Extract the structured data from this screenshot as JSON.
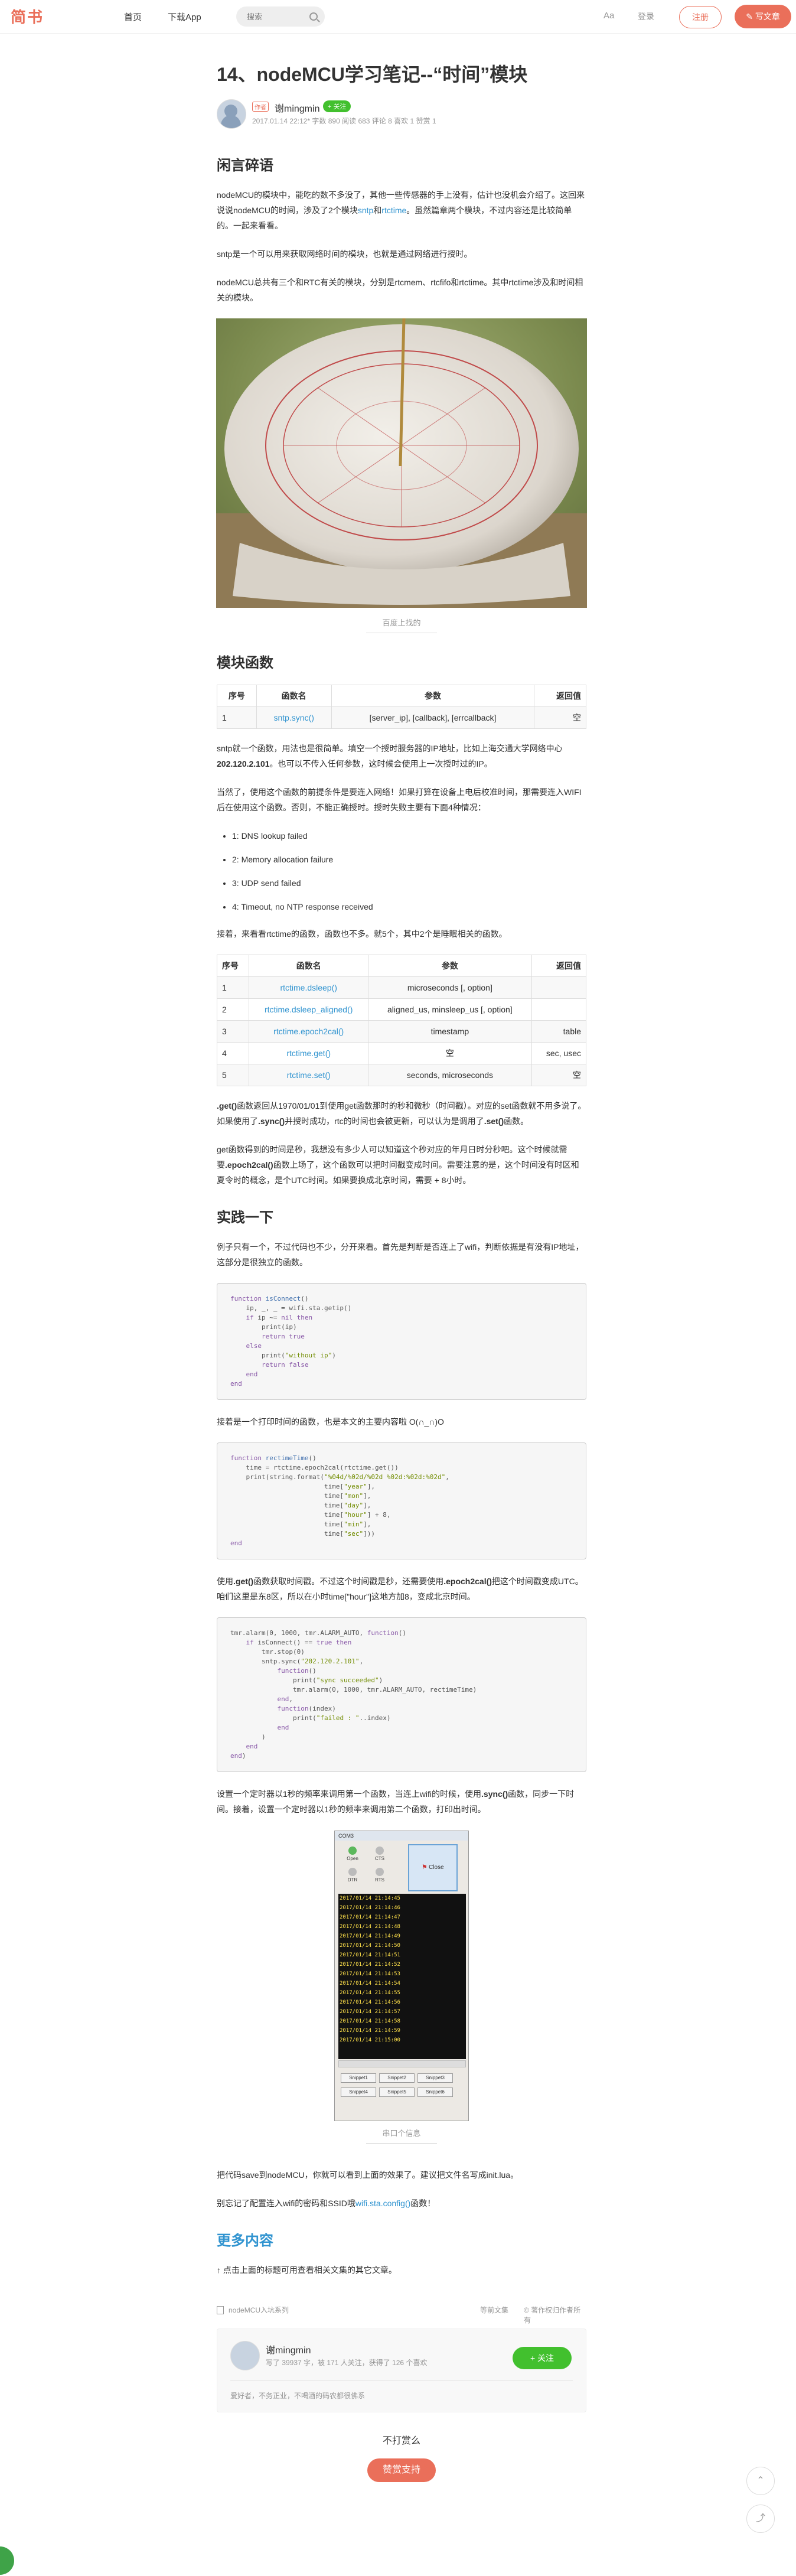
{
  "nav": {
    "logo": "简书",
    "home": "首页",
    "download": "下载App",
    "search_placeholder": "搜索",
    "aa": "Aa",
    "login": "登录",
    "signup": "注册",
    "write": "✎ 写文章"
  },
  "article": {
    "title": "14、nodeMCU学习笔记--“时间”模块",
    "author": {
      "tag": "作者",
      "name": "谢mingmin",
      "follow": "+ 关注",
      "meta": "2017.01.14 22:12* 字数 890 阅读 683 评论 8 喜欢 1 赞赏 1"
    },
    "h_intro": "闲言碎语",
    "p1a": "nodeMCU的模块中，能吃的数不多没了，其他一些传感器的手上没有，估计也没机会介绍了。这回来说说nodeMCU的时间，涉及了2个模块",
    "p1_link1": "sntp",
    "p1_and": "和",
    "p1_link2": "rtctime",
    "p1b": "。虽然篇章两个模块，不过内容还是比较简单的。一起来看看。",
    "p2": "sntp是一个可以用来获取网络时间的模块，也就是通过网络进行授时。",
    "p3": "nodeMCU总共有三个和RTC有关的模块，分别是rtcmem、rtcfifo和rtctime。其中rtctime涉及和时间相关的模块。",
    "img1_caption": "百度上找的",
    "h_funcs": "模块函数",
    "table1": {
      "headers": [
        "序号",
        "函数名",
        "参数",
        "返回值"
      ],
      "rows": [
        [
          "1",
          "sntp.sync()",
          "[server_ip], [callback], [errcallback]",
          "空"
        ]
      ]
    },
    "p4a": "sntp就一个函数，用法也是很简单。填空一个授时服务器的IP地址，比如上海交通大学网络中心",
    "p4_bold": "202.120.2.101",
    "p4b": "。也可以不传入任何参数，这时候会使用上一次授时过的IP。",
    "p5": "当然了，使用这个函数的前提条件是要连入网络！如果打算在设备上电后校准时间，那需要连入WIFI后在使用这个函数。否则，不能正确授时。授时失败主要有下面4种情况：",
    "fail_list": [
      "1: DNS lookup failed",
      "2: Memory allocation failure",
      "3: UDP send failed",
      "4: Timeout, no NTP response received"
    ],
    "p6": "接着，来看看rtctime的函数，函数也不多。就5个，其中2个是睡眠相关的函数。",
    "table2": {
      "headers": [
        "序号",
        "函数名",
        "参数",
        "返回值"
      ],
      "rows": [
        [
          "1",
          "rtctime.dsleep()",
          "microseconds [, option]",
          ""
        ],
        [
          "2",
          "rtctime.dsleep_aligned()",
          "aligned_us, minsleep_us [, option]",
          ""
        ],
        [
          "3",
          "rtctime.epoch2cal()",
          "timestamp",
          "table"
        ],
        [
          "4",
          "rtctime.get()",
          "空",
          "sec, usec"
        ],
        [
          "5",
          "rtctime.set()",
          "seconds, microseconds",
          "空"
        ]
      ]
    },
    "p7a": ".get()",
    "p7b": "函数返回从1970/01/01到使用get函数那时的秒和微秒（时间戳）。对应的set函数就不用多说了。如果使用了",
    "p7c": ".sync()",
    "p7d": "并授时成功，rtc的时间也会被更新，可以认为是调用了",
    "p7e": ".set()",
    "p7f": "函数。",
    "p8a": "get函数得到的时间是秒，我想没有多少人可以知道这个秒对应的年月日时分秒吧。这个时候就需要",
    "p8b": ".epoch2cal()",
    "p8c": "函数上场了，这个函数可以把时间戳变成时间。需要注意的是，这个时间没有时区和夏令时的概念，是个UTC时间。如果要换成北京时间，需要 + 8小时。",
    "h_practice": "实践一下",
    "p9": "例子只有一个，不过代码也不少，分开来看。首先是判断是否连上了wifi，判断依据是有没有IP地址，这部分是很独立的函数。",
    "p10": "接着是一个打印时间的函数，也是本文的主要内容啦 O(∩_∩)O",
    "p11a": "使用",
    "p11b": ".get()",
    "p11c": "函数获取时间戳。不过这个时间戳是秒，还需要使用",
    "p11d": ".epoch2cal()",
    "p11e": "把这个时间戳变成UTC。咱们这里是东8区，所以在小时time[\"hour\"]这地方加8，变成北京时间。",
    "p12a": "设置一个定时器以1秒的频率来调用第一个函数，当连上wifi的时候，使用",
    "p12b": ".sync()",
    "p12c": "函数，同步一下时间。接着，设置一个定时器以1秒的频率来调用第二个函数，打印出时间。",
    "img2_caption": "串口个信息",
    "p13": "把代码save到nodeMCU，你就可以看到上面的效果了。建议把文件名写成init.lua。",
    "p14a": "别忘记了配置连入wifi的密码和SSID哦",
    "p14_link": "wifi.sta.config()",
    "p14b": "函数！",
    "h_more": "更多内容",
    "p15": "↑ 点击上面的标题可用查看相关文集的其它文章。",
    "footer_left": "nodeMCU入坑系列",
    "footer_right1": "等前文集",
    "footer_right2": "© 著作权归作者所有",
    "card": {
      "name": "谢mingmin",
      "meta": "写了 39937 字，被 171 人关注，获得了 126 个喜欢",
      "follow": "+ 关注",
      "bio": "爱好者，不务正业，不喝酒的码农都很佛系"
    },
    "support_text": "不打赏么",
    "support_button": "赞赏支持"
  },
  "serial": {
    "title": "COM3",
    "lines": [
      "2017/01/14 21:14:45",
      "2017/01/14 21:14:46",
      "2017/01/14 21:14:47",
      "2017/01/14 21:14:48",
      "2017/01/14 21:14:49",
      "2017/01/14 21:14:50",
      "2017/01/14 21:14:51",
      "2017/01/14 21:14:52",
      "2017/01/14 21:14:53",
      "2017/01/14 21:14:54",
      "2017/01/14 21:14:55",
      "2017/01/14 21:14:56",
      "2017/01/14 21:14:57",
      "2017/01/14 21:14:58",
      "2017/01/14 21:14:59",
      "2017/01/14 21:15:00"
    ],
    "buttons": [
      "Open",
      "CTS",
      "DTR",
      "RTS"
    ],
    "close": "Close",
    "snippets": [
      "Snippet1",
      "Snippet2",
      "Snippet3",
      "Snippet4",
      "Snippet5",
      "Snippet6"
    ]
  },
  "colors": {
    "brand": "#ea6f5a",
    "link": "#3194d0",
    "follow": "#42c02e"
  }
}
